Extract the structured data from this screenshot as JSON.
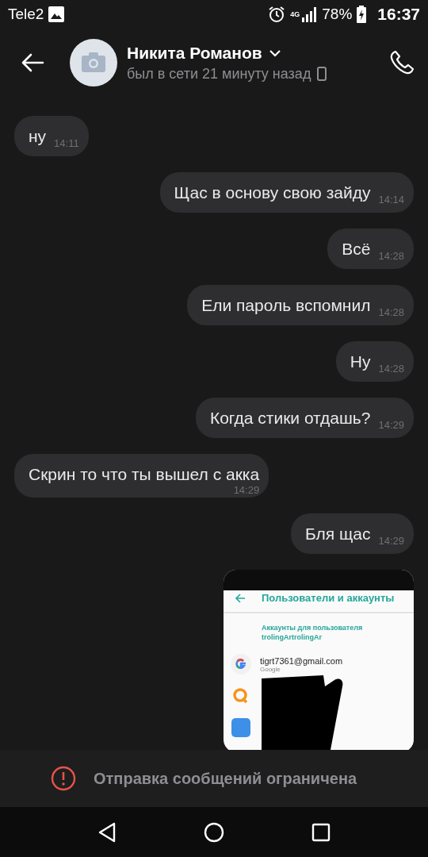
{
  "status_bar": {
    "carrier": "Tele2",
    "network": "4G",
    "battery": "78%",
    "time": "16:37"
  },
  "header": {
    "name": "Никита Романов",
    "status": "был в сети 21 минуту назад"
  },
  "messages": [
    {
      "kind": "in",
      "text": "ну",
      "time": "14:11"
    },
    {
      "kind": "out",
      "text": "Щас в основу свою зайду",
      "time": "14:14"
    },
    {
      "kind": "out",
      "text": "Всё",
      "time": "14:28"
    },
    {
      "kind": "out",
      "text": "Ели пароль вспомнил",
      "time": "14:28"
    },
    {
      "kind": "out",
      "text": "Ну",
      "time": "14:28"
    },
    {
      "kind": "out",
      "text": "Когда стики отдашь?",
      "time": "14:29"
    },
    {
      "kind": "in",
      "text": "Скрин то что ты вышел с акка",
      "time": "14:29"
    },
    {
      "kind": "out",
      "text": "Бля щас",
      "time": "14:29"
    },
    {
      "kind": "image",
      "screenshot": {
        "title": "Пользователи и аккаунты",
        "section_heading": [
          "Аккаунты для пользователя",
          "trolingArtrolingAr"
        ],
        "accounts": [
          {
            "kind": "google",
            "email": "tigrt7361@gmail.com",
            "provider": "Google"
          },
          {
            "kind": "qiwi"
          },
          {
            "kind": "blue"
          }
        ]
      }
    }
  ],
  "notice": {
    "text": "Отправка сообщений ограничена"
  }
}
